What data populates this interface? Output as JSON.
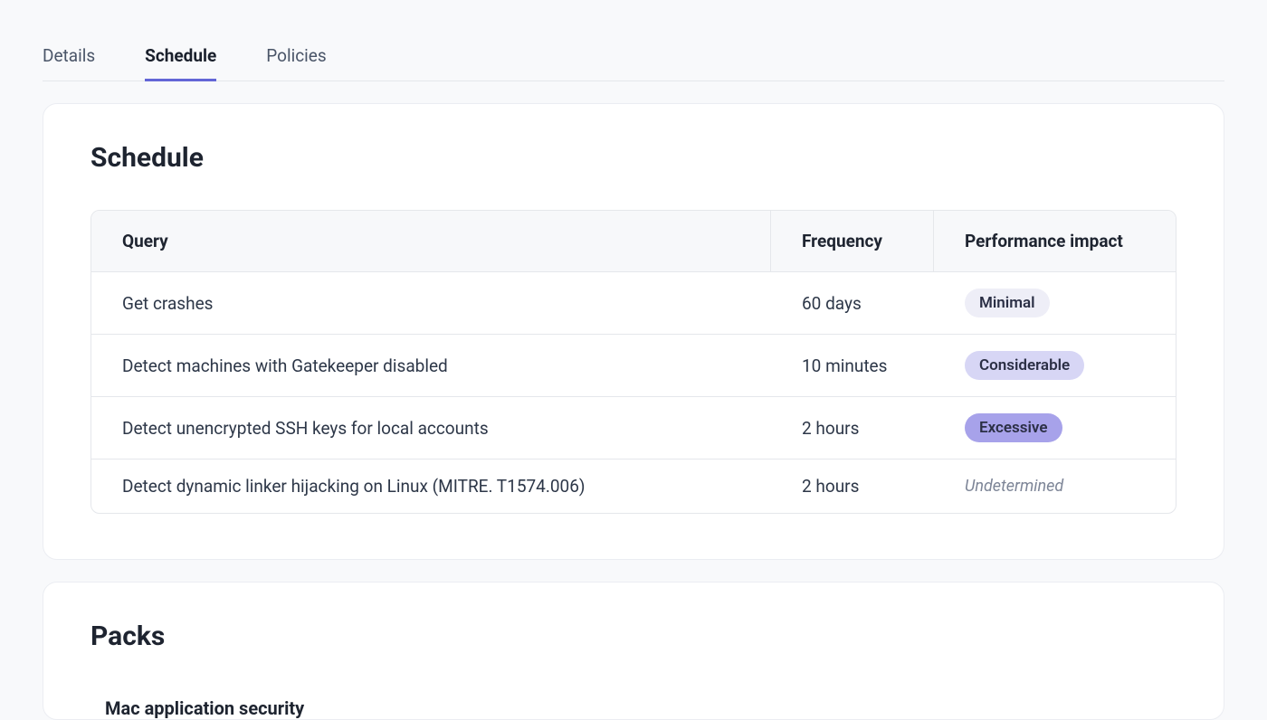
{
  "tabs": [
    {
      "label": "Details",
      "active": false
    },
    {
      "label": "Schedule",
      "active": true
    },
    {
      "label": "Policies",
      "active": false
    }
  ],
  "schedule": {
    "title": "Schedule",
    "columns": {
      "query": "Query",
      "frequency": "Frequency",
      "impact": "Performance impact"
    },
    "rows": [
      {
        "query": "Get crashes",
        "frequency": "60 days",
        "impact": "Minimal",
        "impactLevel": "minimal"
      },
      {
        "query": "Detect machines with Gatekeeper disabled",
        "frequency": "10 minutes",
        "impact": "Considerable",
        "impactLevel": "considerable"
      },
      {
        "query": "Detect unencrypted SSH keys for local accounts",
        "frequency": "2 hours",
        "impact": "Excessive",
        "impactLevel": "excessive"
      },
      {
        "query": "Detect dynamic linker hijacking on Linux (MITRE. T1574.006)",
        "frequency": "2 hours",
        "impact": "Undetermined",
        "impactLevel": "undetermined"
      }
    ]
  },
  "packs": {
    "title": "Packs",
    "items": [
      {
        "name": "Mac application security"
      }
    ]
  }
}
